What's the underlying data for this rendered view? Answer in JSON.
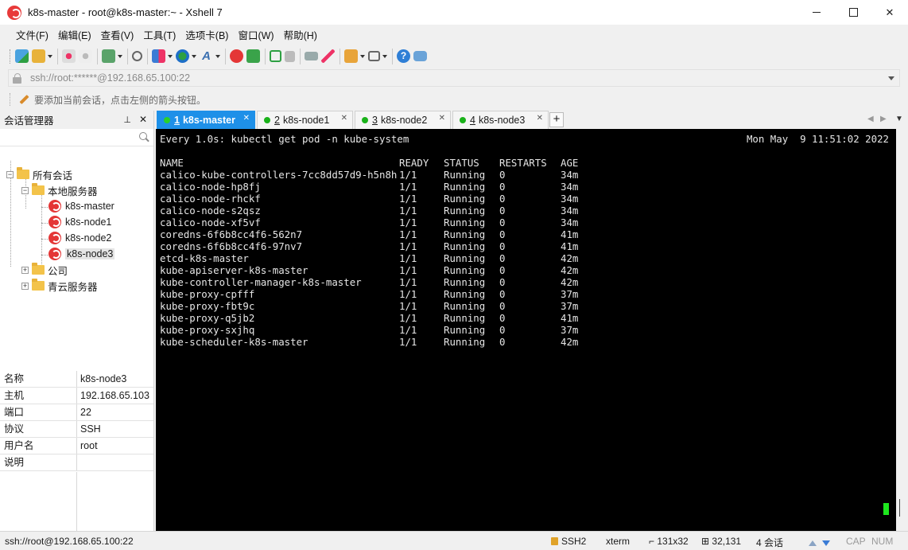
{
  "window": {
    "title": "k8s-master - root@k8s-master:~ - Xshell 7"
  },
  "menu": [
    "文件(F)",
    "编辑(E)",
    "查看(V)",
    "工具(T)",
    "选项卡(B)",
    "窗口(W)",
    "帮助(H)"
  ],
  "toolbar": {
    "icons": [
      "new-session-icon",
      "open-folder-icon",
      "disconnect-icon",
      "reconnect-icon",
      "properties-icon",
      "find-icon",
      "transfer-icon",
      "globe-icon",
      "font-icon",
      "xshell-icon",
      "xftp-icon",
      "fullscreen-icon",
      "lock-icon",
      "keyboard-icon",
      "highlight-icon",
      "add-tab-icon",
      "layout-icon",
      "help-icon",
      "chat-icon"
    ]
  },
  "address": {
    "value": "ssh://root:******@192.168.65.100:22"
  },
  "hint": {
    "text": "要添加当前会话，点击左侧的箭头按钮。"
  },
  "session_manager": {
    "title": "会话管理器",
    "pin": "⊥",
    "close": "✕",
    "tree": {
      "root": "所有会话",
      "local_folder": "本地服务器",
      "sessions": [
        "k8s-master",
        "k8s-node1",
        "k8s-node2",
        "k8s-node3"
      ],
      "folders": [
        "公司",
        "青云服务器"
      ]
    },
    "properties": [
      {
        "key": "名称",
        "value": "k8s-node3"
      },
      {
        "key": "主机",
        "value": "192.168.65.103"
      },
      {
        "key": "端口",
        "value": "22"
      },
      {
        "key": "协议",
        "value": "SSH"
      },
      {
        "key": "用户名",
        "value": "root"
      },
      {
        "key": "说明",
        "value": ""
      }
    ]
  },
  "tabs": [
    {
      "num": "1",
      "label": "k8s-master",
      "active": true
    },
    {
      "num": "2",
      "label": "k8s-node1",
      "active": false
    },
    {
      "num": "3",
      "label": "k8s-node2",
      "active": false
    },
    {
      "num": "4",
      "label": "k8s-node3",
      "active": false
    }
  ],
  "tab_add": "+",
  "terminal": {
    "command": "Every 1.0s: kubectl get pod -n kube-system",
    "clock": "Mon May  9 11:51:02 2022",
    "headers": [
      "NAME",
      "READY",
      "STATUS",
      "RESTARTS",
      "AGE"
    ],
    "rows": [
      [
        "calico-kube-controllers-7cc8dd57d9-h5n8h",
        "1/1",
        "Running",
        "0",
        "34m"
      ],
      [
        "calico-node-hp8fj",
        "1/1",
        "Running",
        "0",
        "34m"
      ],
      [
        "calico-node-rhckf",
        "1/1",
        "Running",
        "0",
        "34m"
      ],
      [
        "calico-node-s2qsz",
        "1/1",
        "Running",
        "0",
        "34m"
      ],
      [
        "calico-node-xf5vf",
        "1/1",
        "Running",
        "0",
        "34m"
      ],
      [
        "coredns-6f6b8cc4f6-562n7",
        "1/1",
        "Running",
        "0",
        "41m"
      ],
      [
        "coredns-6f6b8cc4f6-97nv7",
        "1/1",
        "Running",
        "0",
        "41m"
      ],
      [
        "etcd-k8s-master",
        "1/1",
        "Running",
        "0",
        "42m"
      ],
      [
        "kube-apiserver-k8s-master",
        "1/1",
        "Running",
        "0",
        "42m"
      ],
      [
        "kube-controller-manager-k8s-master",
        "1/1",
        "Running",
        "0",
        "42m"
      ],
      [
        "kube-proxy-cpfff",
        "1/1",
        "Running",
        "0",
        "37m"
      ],
      [
        "kube-proxy-fbt9c",
        "1/1",
        "Running",
        "0",
        "37m"
      ],
      [
        "kube-proxy-q5jb2",
        "1/1",
        "Running",
        "0",
        "41m"
      ],
      [
        "kube-proxy-sxjhq",
        "1/1",
        "Running",
        "0",
        "37m"
      ],
      [
        "kube-scheduler-k8s-master",
        "1/1",
        "Running",
        "0",
        "42m"
      ]
    ]
  },
  "statusbar": {
    "connection": "ssh://root@192.168.65.100:22",
    "protocol": "SSH2",
    "term": "xterm",
    "size": "131x32",
    "cursor_pos": "32,131",
    "sessions": "4 会话",
    "cap": "CAP",
    "num": "NUM"
  },
  "colors": {
    "tab_active": "#1e90e8",
    "terminal_bg": "#000000",
    "cursor": "#1ee61e",
    "session_icon": "#e43636"
  }
}
